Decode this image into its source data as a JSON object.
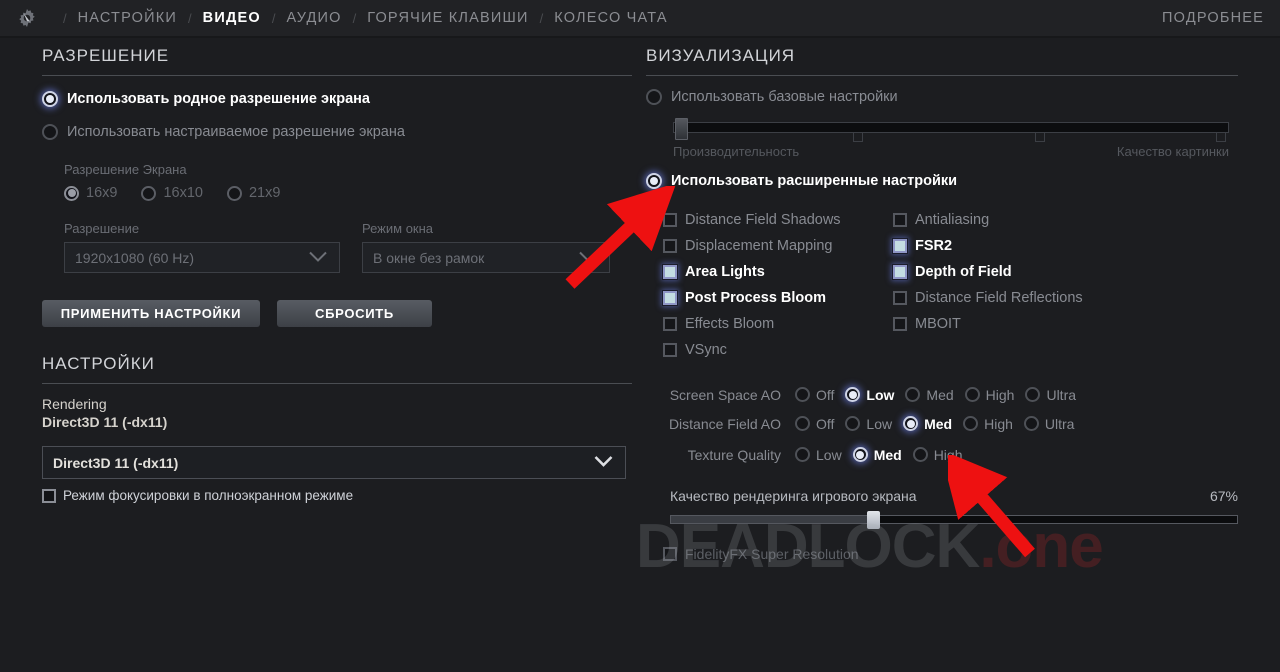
{
  "header": {
    "gear_icon": "gear-icon",
    "separator": "/",
    "tabs": [
      {
        "label": "НАСТРОЙКИ",
        "active": false
      },
      {
        "label": "ВИДЕО",
        "active": true
      },
      {
        "label": "АУДИО",
        "active": false
      },
      {
        "label": "ГОРЯЧИЕ КЛАВИШИ",
        "active": false
      },
      {
        "label": "КОЛЕСО ЧАТА",
        "active": false
      }
    ],
    "more_label": "ПОДРОБНЕЕ"
  },
  "resolution": {
    "section_title": "РАЗРЕШЕНИЕ",
    "native_label": "Использовать родное разрешение экрана",
    "custom_label": "Использовать настраиваемое разрешение экрана",
    "aspect_label": "Разрешение Экрана",
    "aspect_options": [
      "16x9",
      "16x10",
      "21x9"
    ],
    "aspect_selected": "16x9",
    "resolution_label": "Разрешение",
    "resolution_value": "1920x1080 (60 Hz)",
    "window_mode_label": "Режим окна",
    "window_mode_value": "В окне без рамок",
    "apply_button": "ПРИМЕНИТЬ НАСТРОЙКИ",
    "reset_button": "СБРОСИТЬ"
  },
  "settings": {
    "section_title": "НАСТРОЙКИ",
    "rendering_label": "Rendering",
    "rendering_value": "Direct3D 11 (-dx11)",
    "api_select_value": "Direct3D 11 (-dx11)",
    "focus_mode_label": "Режим фокусировки в полноэкранном режиме",
    "focus_mode_checked": false
  },
  "visuals": {
    "section_title": "ВИЗУАЛИЗАЦИЯ",
    "basic_label": "Использовать базовые настройки",
    "basic_selected": false,
    "quality_slider": {
      "left_label": "Производительность",
      "right_label": "Качество картинки",
      "value_percent": 2,
      "ticks_percent": [
        33,
        66,
        100
      ],
      "enabled": false
    },
    "advanced_label": "Использовать расширенные настройки",
    "advanced_selected": true,
    "checkboxes_left": [
      {
        "label": "Distance Field Shadows",
        "checked": false,
        "enabled": false
      },
      {
        "label": "Displacement Mapping",
        "checked": false,
        "enabled": false
      },
      {
        "label": "Area Lights",
        "checked": true,
        "enabled": true
      },
      {
        "label": "Post Process Bloom",
        "checked": true,
        "enabled": true
      },
      {
        "label": "Effects Bloom",
        "checked": false,
        "enabled": false
      },
      {
        "label": "VSync",
        "checked": false,
        "enabled": false
      }
    ],
    "checkboxes_right": [
      {
        "label": "Antialiasing",
        "checked": false,
        "enabled": false
      },
      {
        "label": "FSR2",
        "checked": true,
        "enabled": true
      },
      {
        "label": "Depth of Field",
        "checked": true,
        "enabled": true
      },
      {
        "label": "Distance Field Reflections",
        "checked": false,
        "enabled": false
      },
      {
        "label": "MBOIT",
        "checked": false,
        "enabled": false
      }
    ],
    "quality_rows": [
      {
        "label": "Screen Space AO",
        "options": [
          "Off",
          "Low",
          "Med",
          "High",
          "Ultra"
        ],
        "selected": "Low"
      },
      {
        "label": "Distance Field AO",
        "options": [
          "Off",
          "Low",
          "Med",
          "High",
          "Ultra"
        ],
        "selected": "Med"
      },
      {
        "label": "Texture Quality",
        "options": [
          "Low",
          "Med",
          "High"
        ],
        "selected": "Med"
      }
    ],
    "render_scale": {
      "label": "Качество рендеринга игрового экрана",
      "value_label": "67%",
      "value_percent": 36
    },
    "fsr_label": "FidelityFX Super Resolution",
    "fsr_checked": false
  },
  "watermark": {
    "part_a": "DEADLOCK",
    "part_b": ".one"
  },
  "colors": {
    "background": "#1c1d20",
    "header": "#212225",
    "accent_blue": "#c9e2e6",
    "arrow_red": "#ee1111",
    "text_bright": "#ffffff",
    "text_dim": "#888b92"
  }
}
